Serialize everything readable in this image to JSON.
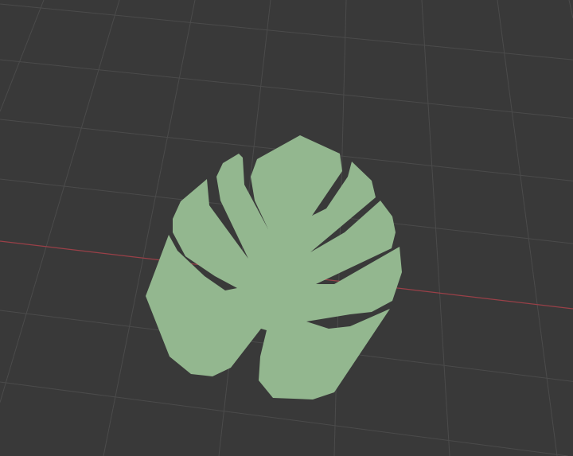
{
  "viewport": {
    "background_color": "#393939",
    "grid_color": "#4b4b4b",
    "x_axis_color": "#9a4048",
    "object": {
      "name": "monstera-leaf",
      "color": "#93b78f"
    }
  }
}
